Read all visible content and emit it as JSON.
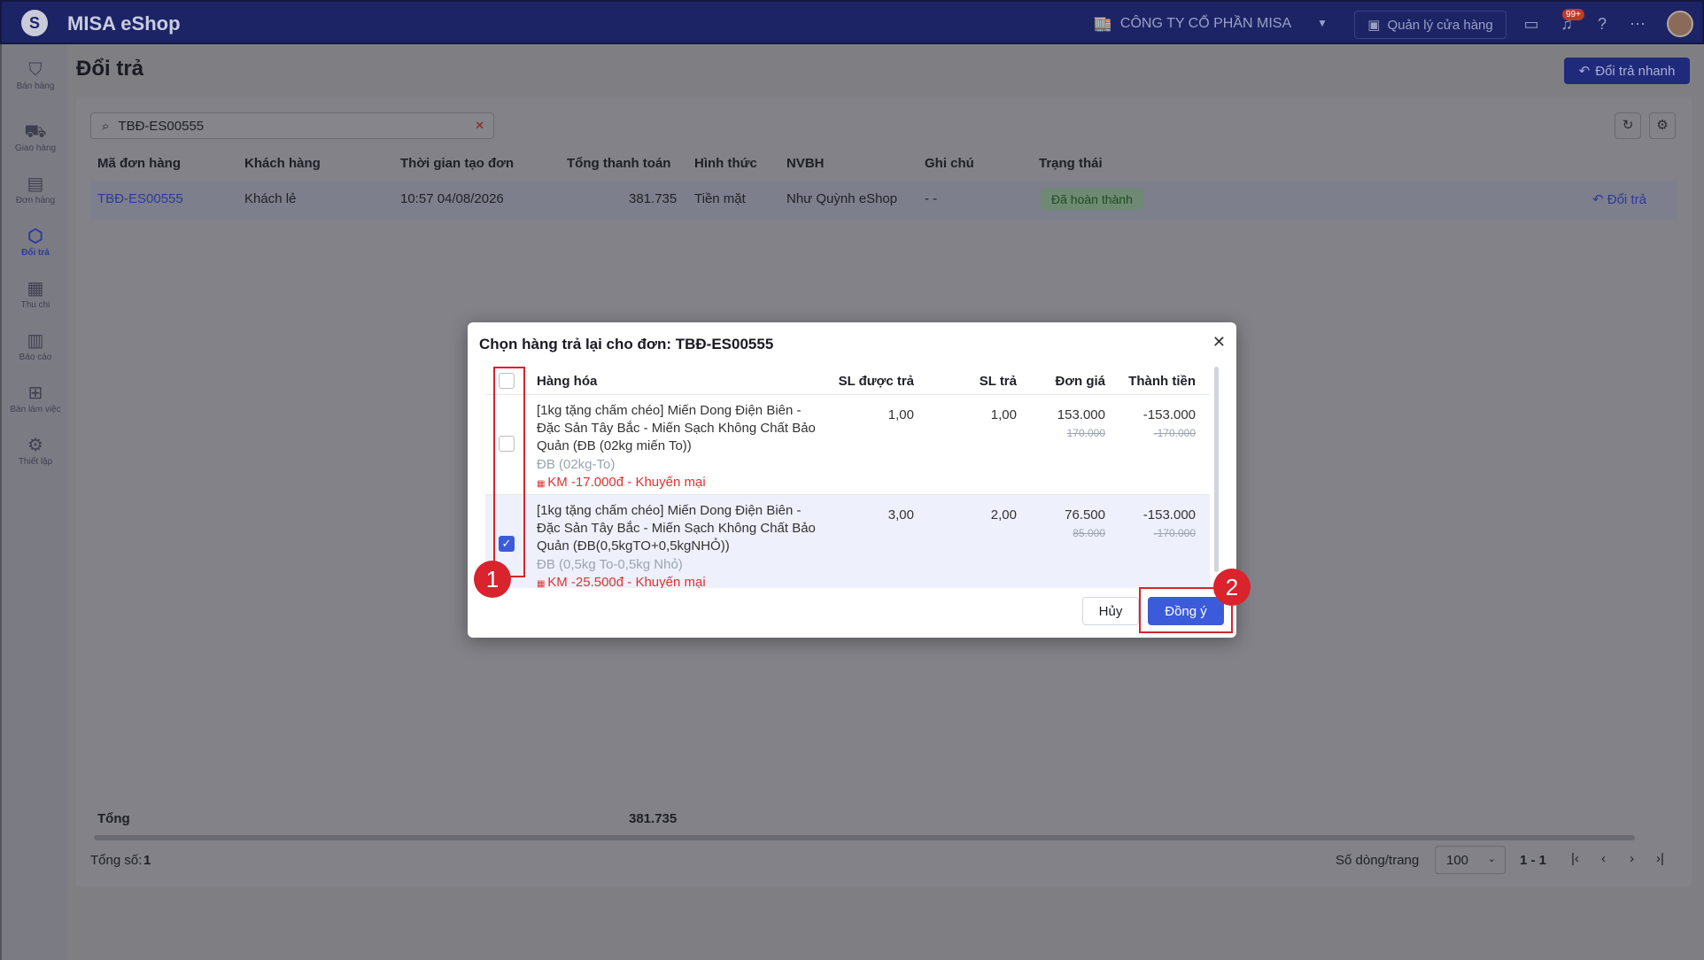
{
  "app": {
    "title": "MISA eShop",
    "company": "CÔNG TY CỔ PHẦN MISA",
    "store_button": "Quản lý cửa hàng",
    "notification_badge": "99+"
  },
  "sidebar": {
    "items": [
      {
        "label": "Bán hàng",
        "icon": "shopping-bag-icon"
      },
      {
        "label": "Giao hàng",
        "icon": "truck-icon"
      },
      {
        "label": "Đơn hàng",
        "icon": "clipboard-icon"
      },
      {
        "label": "Đổi trả",
        "icon": "box-return-icon",
        "active": true
      },
      {
        "label": "Thu chi",
        "icon": "cash-icon"
      },
      {
        "label": "Báo cáo",
        "icon": "chart-icon"
      },
      {
        "label": "Bàn làm việc",
        "icon": "grid-icon"
      },
      {
        "label": "Thiết lập",
        "icon": "gear-icon"
      }
    ]
  },
  "page": {
    "title": "Đổi trả",
    "quick_button": "Đổi trả nhanh"
  },
  "search": {
    "value": "TBĐ-ES00555"
  },
  "grid": {
    "headers": {
      "code": "Mã đơn hàng",
      "customer": "Khách hàng",
      "created": "Thời gian tạo đơn",
      "total": "Tổng thanh toán",
      "method": "Hình thức",
      "staff": "NVBH",
      "note": "Ghi chú",
      "status": "Trạng thái"
    },
    "rows": [
      {
        "code": "TBĐ-ES00555",
        "customer": "Khách lẻ",
        "created": "10:57 04/08/2026",
        "total": "381.735",
        "method": "Tiền mặt",
        "staff": "Như Quỳnh eShop",
        "note": "- -",
        "status": "Đã hoàn thành",
        "action": "Đổi trả"
      }
    ]
  },
  "footer": {
    "total_label": "Tổng",
    "total_value": "381.735",
    "count_label": "Tổng số:",
    "count_value": "1",
    "rows_per_page_label": "Số dòng/trang",
    "rows_per_page": "100",
    "range": "1 - 1"
  },
  "modal": {
    "title": "Chọn hàng trả lại cho đơn: TBĐ-ES00555",
    "headers": {
      "product": "Hàng hóa",
      "qty_allowed": "SL được trả",
      "qty_return": "SL trả",
      "unit_price": "Đơn giá",
      "amount": "Thành tiền"
    },
    "items": [
      {
        "name": "[1kg tặng chấm chéo] Miến Dong Điện Biên - Đặc Sản Tây Bắc - Miến Sạch Không Chất Bảo Quản (ĐB (02kg miến To))",
        "variant": "ĐB (02kg-To)",
        "promo": "KM -17.000đ - Khuyến mại",
        "qty_allowed": "1,00",
        "qty_return": "1,00",
        "unit_price": "153.000",
        "unit_price_old": "170.000",
        "amount": "-153.000",
        "amount_old": "-170.000",
        "checked": false
      },
      {
        "name": "[1kg tặng chấm chéo] Miến Dong Điện Biên - Đặc Sản Tây Bắc - Miến Sạch Không Chất Bảo Quản (ĐB(0,5kgTO+0,5kgNHỎ))",
        "variant": "ĐB (0,5kg To-0,5kg Nhỏ)",
        "promo": "KM -25.500đ - Khuyến mại",
        "qty_allowed": "3,00",
        "qty_return": "2,00",
        "unit_price": "76.500",
        "unit_price_old": "85.000",
        "amount": "-153.000",
        "amount_old": "-170.000",
        "checked": true
      }
    ],
    "cancel": "Hủy",
    "ok": "Đồng ý"
  },
  "annotations": {
    "step1": "1",
    "step2": "2"
  },
  "colors": {
    "primary": "#3b5bdb",
    "topbar": "#1c2466",
    "annotation": "#d9232d",
    "promo": "#e03131"
  }
}
